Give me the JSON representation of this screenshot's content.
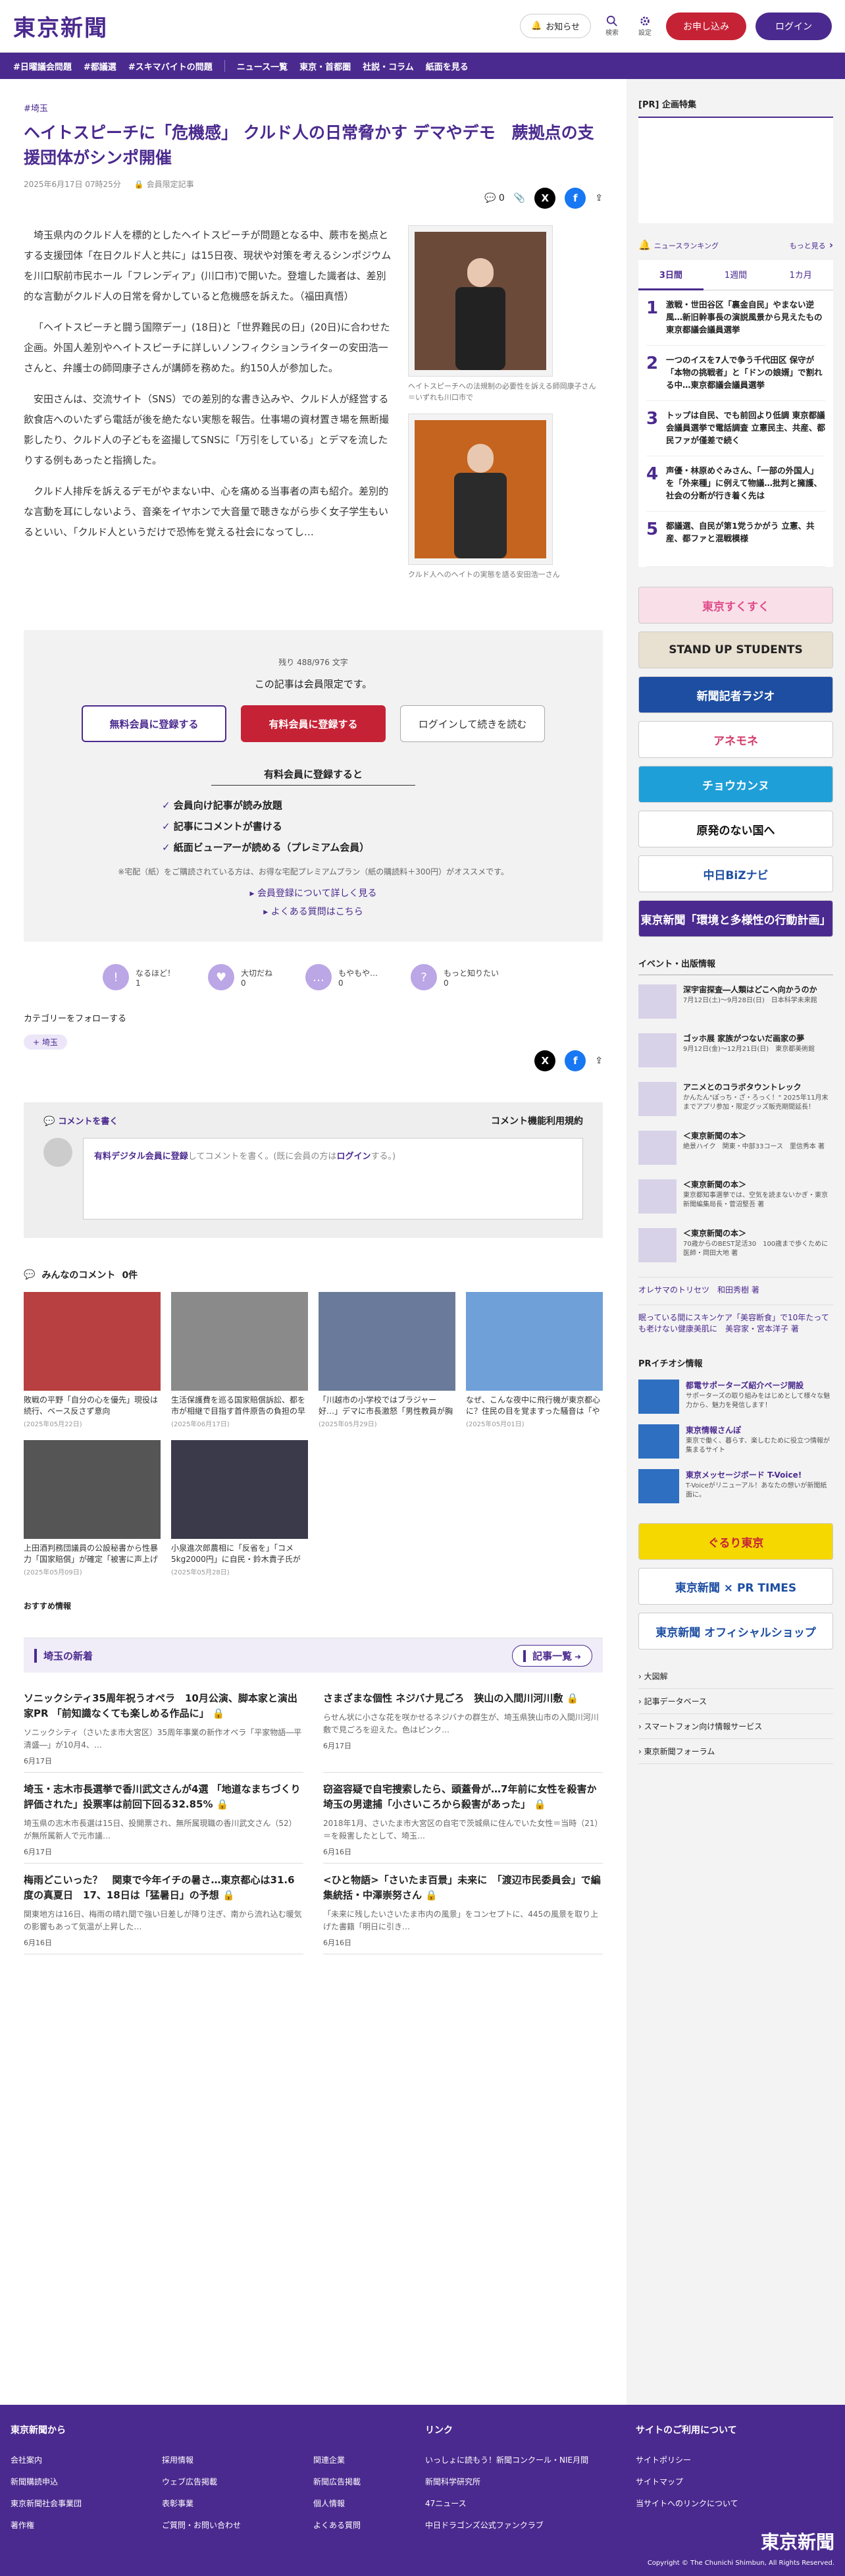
{
  "header": {
    "logo": "東京新聞",
    "notice": "お知らせ",
    "search": "検索",
    "settings": "設定",
    "apply": "お申し込み",
    "login": "ログイン"
  },
  "nav": [
    "#日曜議会問題",
    "#都議選",
    "#スキマバイトの問題",
    "ニュース一覧",
    "東京・首都圏",
    "社説・コラム",
    "紙面を見る"
  ],
  "article": {
    "tag": "#埼玉",
    "title": "ヘイトスピーチに「危機感」 クルド人の日常脅かす デマやデモ　蕨拠点の支援団体がシンポ開催",
    "date": "2025年6月17日 07時25分",
    "members": "会員限定記事",
    "comment_count": "0",
    "paragraphs": [
      "埼玉県内のクルド人を標的としたヘイトスピーチが問題となる中、蕨市を拠点とする支援団体「在日クルド人と共に」は15日夜、現状や対策を考えるシンポジウムを川口駅前市民ホール「フレンディア」(川口市)で開いた。登壇した識者は、差別的な言動がクルド人の日常を脅かしていると危機感を訴えた。（福田真悟）",
      "「ヘイトスピーチと闘う国際デー」(18日)と「世界難民の日」(20日)に合わせた企画。外国人差別やヘイトスピーチに詳しいノンフィクションライターの安田浩一さんと、弁護士の師岡康子さんが講師を務めた。約150人が参加した。",
      "安田さんは、交流サイト（SNS）での差別的な書き込みや、クルド人が経営する飲食店へのいたずら電話が後を絶たない実態を報告。仕事場の資材置き場を無断撮影したり、クルド人の子どもを盗撮してSNSに「万引をしている」とデマを流したりする例もあったと指摘した。",
      "クルド人排斥を訴えるデモがやまない中、心を痛める当事者の声も紹介。差別的な言動を耳にしないよう、音楽をイヤホンで大音量で聴きながら歩く女子学生もいるといい、「クルド人というだけで恐怖を覚える社会になってし…"
    ],
    "captions": [
      "ヘイトスピーチへの法規制の必要性を訴える師岡康子さん＝いずれも川口市で",
      "クルド人へのヘイトの実態を語る安田浩一さん"
    ]
  },
  "gate": {
    "remaining": "残り 488/976 文字",
    "message": "この記事は会員限定です。",
    "free": "無料会員に登録する",
    "paid": "有料会員に登録する",
    "login": "ログインして続きを読む",
    "benefit_title": "有料会員に登録すると",
    "benefits": [
      "会員向け記事が読み放題",
      "記事にコメントが書ける",
      "紙面ビューアーが読める（プレミアム会員）"
    ],
    "note": "※宅配（紙）をご購読されている方は、お得な宅配プレミアムプラン（紙の購読料＋300円）がオススメです。",
    "link1": "会員登録について詳しく見る",
    "link2": "よくある質問はこちら"
  },
  "reactions": [
    {
      "label": "なるほど！",
      "count": "1",
      "icon": "!"
    },
    {
      "label": "大切だね",
      "count": "0",
      "icon": "♥"
    },
    {
      "label": "もやもや…",
      "count": "0",
      "icon": "…"
    },
    {
      "label": "もっと知りたい",
      "count": "0",
      "icon": "?"
    }
  ],
  "follow": {
    "label": "カテゴリーをフォローする",
    "chip": "埼玉"
  },
  "comment": {
    "head": "コメントを書く",
    "rules": "コメント機能利用規約",
    "prompt_link": "有料デジタル会員に登録",
    "prompt_mid": "してコメントを書く。(既に会員の方は",
    "prompt_login": "ログイン",
    "prompt_end": "する。)"
  },
  "all_comments": {
    "label": "みんなのコメント",
    "count": "0件"
  },
  "cards": [
    {
      "title": "敗戦の平野「自分の心を優先」現役は続行、ベース反さず意向",
      "date": "(2025年05月22日)",
      "color": "#b84040"
    },
    {
      "title": "生活保護費を巡る国家賠償訴訟、都を市が相継で目指す首件原告の負担の早期解決などを…",
      "date": "(2025年06月17日)",
      "color": "#8a8a8a"
    },
    {
      "title": "「川越市の小学校ではブラジャー好…」デマに市長激怒「男性教員が胸の成長を見て許可」…",
      "date": "(2025年05月29日)",
      "color": "#6a7a9a"
    },
    {
      "title": "なぜ、こんな夜中に飛行機が東京都心に？住民の目を覚ますった騒音は「やむを得ず…」(ニ…",
      "date": "(2025年05月01日)",
      "color": "#6fa0d8"
    },
    {
      "title": "上田酒判務団議員の公設秘書から性暴力「国家賠償」が確定「被害に声上げることためら…",
      "date": "(2025年05月09日)",
      "color": "#555"
    },
    {
      "title": "小泉進次郎農相に「反省を」「コメ5kg2000円」に自民・鈴木貴子氏が苦言　立憲民主・…",
      "date": "(2025年05月28日)",
      "color": "#3a3a4a"
    }
  ],
  "recommend": "おすすめ情報",
  "local": {
    "title": "埼玉の新着",
    "more": "記事一覧",
    "items": [
      {
        "title": "ソニックシティ35周年祝うオペラ　10月公演、脚本家と演出家PR 「前知識なくても楽しめる作品に」",
        "sub": "ソニックシティ（さいたま市大宮区）35周年事業の新作オペラ「平家物語―平清盛―」が10月4、…",
        "date": "6月17日"
      },
      {
        "title": "さまざまな個性 ネジバナ見ごろ　狭山の入間川河川敷",
        "sub": "らせん状に小さな花を咲かせるネジバナの群生が、埼玉県狭山市の入間川河川敷で見ごろを迎えた。色はピンク…",
        "date": "6月17日"
      },
      {
        "title": "埼玉・志木市長選挙で香川武文さんが4選 「地道なまちづくり評価された」投票率は前回下回る32.85%",
        "sub": "埼玉県の志木市長選は15日、投開票され、無所属現職の香川武文さん（52）が無所属新人で元市議…",
        "date": "6月17日"
      },
      {
        "title": "窃盗容疑で自宅捜索したら、頭蓋骨が…7年前に女性を殺害か　埼玉の男逮捕「小さいころから殺害があった」",
        "sub": "2018年1月、さいたま市大宮区の自宅で茨城県に住んでいた女性＝当時（21）＝を殺害したとして、埼玉…",
        "date": "6月16日"
      },
      {
        "title": "梅雨どこいった？　関東で今年イチの暑さ…東京都心は31.6度の真夏日　17、18日は「猛暑日」の予想",
        "sub": "関東地方は16日、梅雨の晴れ間で強い日差しが降り注ぎ、南から流れ込む暖気の影響もあって気温が上昇した…",
        "date": "6月16日"
      },
      {
        "title": "<ひと物語>「さいたま百景」未来に　「渡辺市民委員会」で編集統括・中澤崇努さん",
        "sub": "「未来に残したいさいたま市内の風景」をコンセプトに、445の風景を取り上げた書籍「明日に引き…",
        "date": "6月16日"
      }
    ]
  },
  "side": {
    "pr": "[PR] 企画特集",
    "ranking": {
      "title": "ニュースランキング",
      "more": "もっと見る",
      "tabs": [
        "3日間",
        "1週間",
        "1カ月"
      ],
      "items": [
        "激戦・世田谷区「裏金自民」やまない逆風…新旧幹事長の演説風景から見えたもの 東京都議会議員選挙",
        "一つのイスを7人で争う千代田区 保守が「本物の挑戦者」と「ドンの娘婿」で割れる中…東京都議会議員選挙",
        "トップは自民、でも前回より低調 東京都議会議員選挙で電話調査 立憲民主、共産、都民ファが僅差で続く",
        "声優・林原めぐみさん、「一部の外国人」を「外来種」に例えて物議…批判と擁護、社会の分断が行き着く先は",
        "都議選、自民が第1党うかがう 立憲、共産、都ファと混戦模様"
      ]
    },
    "banners": [
      {
        "text": "東京すくすく",
        "bg": "#f9dfe8",
        "fg": "#e04c8a"
      },
      {
        "text": "STAND UP STUDENTS",
        "bg": "#e8e0d0",
        "fg": "#222"
      },
      {
        "text": "新聞記者ラジオ",
        "bg": "#1d4ea2",
        "fg": "#fff"
      },
      {
        "text": "アネモネ",
        "bg": "#fff",
        "fg": "#d23a6a"
      },
      {
        "text": "チョウカンヌ",
        "bg": "#1f9fd8",
        "fg": "#fff"
      },
      {
        "text": "原発のない国へ",
        "bg": "#fff",
        "fg": "#111"
      },
      {
        "text": "中日BiZナビ",
        "bg": "#fff",
        "fg": "#1d4ea2"
      },
      {
        "text": "東京新聞「環境と多様性の行動計画」",
        "bg": "#4b2a8f",
        "fg": "#fff"
      }
    ],
    "events_head": "イベント・出版情報",
    "events": [
      {
        "title": "深宇宙探査―人類はどこへ向かうのか",
        "sub": "7月12日(土)～9月28日(日)　日本科学未来館"
      },
      {
        "title": "ゴッホ展 家族がつないだ画家の夢",
        "sub": "9月12日(金)～12月21日(日)　東京都美術館"
      },
      {
        "title": "アニメとのコラボタウントレック",
        "sub": "かんたん\"ぽっち・ざ・ろっく！\" 2025年11月末までアプリ参加・限定グッズ販売期間延長！"
      },
      {
        "title": "＜東京新聞の本＞",
        "sub": "絶景ハイク　関東・中部33コース　里信秀本 著"
      },
      {
        "title": "＜東京新聞の本＞",
        "sub": "東京都知事選挙では、空気を読まないかぎ・東京新聞編集局長・菅沼堅吾 著"
      },
      {
        "title": "＜東京新聞の本＞",
        "sub": "70歳からのBEST足活30　100歳まで歩くために　医師・岡田大地 著"
      }
    ],
    "authors": [
      "オレサマのトリセツ　和田秀樹 著",
      "眠っている間にスキンケア「美容断食」で10年たっても老けない健康美肌に　美容家・宮本洋子 著"
    ],
    "pr_info_head": "PRイチオシ情報",
    "pr_info": [
      {
        "title": "都電サポーターズ紹介ページ開設",
        "sub": "サポーターズの取り組みをはじめとして様々な魅力から、魅力を発信します！"
      },
      {
        "title": "東京情報さんぽ",
        "sub": "東京で働く、暮らす、楽しむために役立つ情報が集まるサイト"
      },
      {
        "title": "東京メッセージボード T-Voice!",
        "sub": "T-Voiceがリニューアル！あなたの想いが新聞紙面に。"
      }
    ],
    "pr_banners": [
      "ぐるり東京",
      "東京新聞 × PR TIMES",
      "東京新聞 オフィシャルショップ"
    ],
    "links": [
      "大図解",
      "記事データベース",
      "スマートフォン向け情報サービス",
      "東京新聞フォーラム"
    ]
  },
  "footer": {
    "cols": [
      {
        "head": "東京新聞から",
        "rows": [
          [
            "会社案内",
            "採用情報",
            "関連企業"
          ],
          [
            "新聞購読申込",
            "ウェブ広告掲載",
            "新聞広告掲載"
          ],
          [
            "東京新聞社会事業団",
            "表彰事業",
            "個人情報"
          ],
          [
            "著作権",
            "ご質問・お問い合わせ",
            "よくある質問"
          ]
        ]
      },
      {
        "head": "リンク",
        "rows": [
          [
            "いっしょに読もう！新聞コンクール・NIE月間"
          ],
          [
            "新聞科学研究所"
          ],
          [
            "47ニュース"
          ],
          [
            "中日ドラゴンズ公式ファンクラブ"
          ]
        ]
      },
      {
        "head": "サイトのご利用について",
        "rows": [
          [
            "サイトポリシー"
          ],
          [
            "サイトマップ"
          ],
          [
            "当サイトへのリンクについて"
          ]
        ]
      }
    ],
    "logo": "東京新聞",
    "copyright": "Copyright © The Chunichi Shimbun, All Rights Reserved."
  }
}
